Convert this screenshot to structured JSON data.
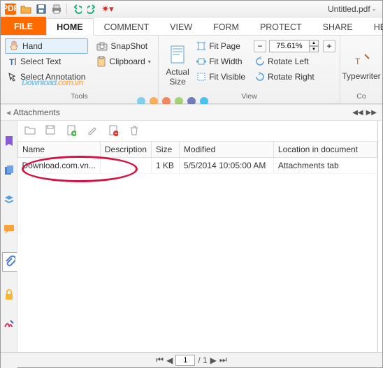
{
  "title": "Untitled.pdf -",
  "tabs": {
    "file": "FILE",
    "home": "HOME",
    "comment": "COMMENT",
    "view": "VIEW",
    "form": "FORM",
    "protect": "PROTECT",
    "share": "SHARE",
    "help": "HELP"
  },
  "ribbon": {
    "tools": {
      "hand": "Hand",
      "select_text": "Select Text",
      "select_annotation": "Select Annotation",
      "snapshot": "SnapShot",
      "clipboard": "Clipboard",
      "group_label": "Tools"
    },
    "view": {
      "actual_size": "Actual Size",
      "fit_page": "Fit Page",
      "fit_width": "Fit Width",
      "fit_visible": "Fit Visible",
      "zoom": "75.61%",
      "rotate_left": "Rotate Left",
      "rotate_right": "Rotate Right",
      "group_label": "View"
    },
    "typewriter": "Typewriter",
    "co_label": "Co"
  },
  "watermark": {
    "main": "Download",
    "suffix": ".com.vn"
  },
  "dot_colors": [
    "#55c1e8",
    "#f7941d",
    "#f15a24",
    "#82c341",
    "#3b4aa0",
    "#00aeef"
  ],
  "attachments": {
    "panel_title": "Attachments",
    "columns": {
      "name": "Name",
      "description": "Description",
      "size": "Size",
      "modified": "Modified",
      "location": "Location in document"
    },
    "rows": [
      {
        "name": "Download.com.vn...",
        "description": "",
        "size": "1 KB",
        "modified": "5/5/2014 10:05:00 AM",
        "location": "Attachments tab"
      }
    ]
  },
  "status": {
    "page_current": "1",
    "page_total": "/ 1"
  }
}
